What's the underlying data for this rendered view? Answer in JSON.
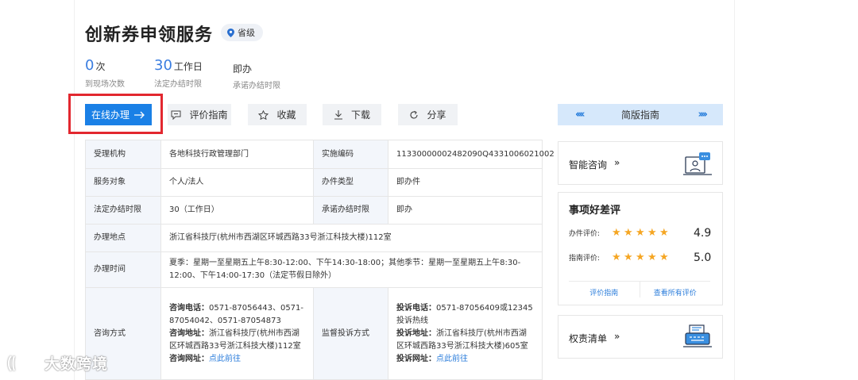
{
  "title": "创新券申领服务",
  "level_badge": "省级",
  "stats": [
    {
      "num": "0",
      "unit": "次",
      "label": "到现场次数"
    },
    {
      "num": "30",
      "unit": "工作日",
      "label": "法定办结时限"
    },
    {
      "text": "即办",
      "label": "承诺办结时限"
    }
  ],
  "toolbar": {
    "online_label": "在线办理",
    "review_label": "评价指南",
    "favorite_label": "收藏",
    "download_label": "下载",
    "share_label": "分享"
  },
  "guide": {
    "label": "简版指南",
    "left_arrows": "‹‹‹‹",
    "right_arrows": "››››"
  },
  "info": {
    "r1": {
      "k1": "受理机构",
      "v1": "各地科技行政管理部门",
      "k2": "实施编码",
      "v2": "11330000002482090Q4331006021002"
    },
    "r2": {
      "k1": "服务对象",
      "v1": "个人/法人",
      "k2": "办件类型",
      "v2": "即办件"
    },
    "r3": {
      "k1": "法定办结时限",
      "v1": "30（工作日）",
      "k2": "承诺办结时限",
      "v2": "即办"
    },
    "r4": {
      "k1": "办理地点",
      "v1": "浙江省科技厅(杭州市西湖区环城西路33号浙江科技大楼)112室"
    },
    "r5": {
      "k1": "办理时间",
      "v1": "夏季：星期一至星期五上午8:30-12:00、下午14:30-18:00；其他季节：星期一至星期五上午8:30-12:00、下午14:00-17:30（法定节假日除外）"
    },
    "r6": {
      "k1": "咨询方式",
      "consult": {
        "phone_label": "咨询电话：",
        "phone": "0571-87056443、0571-87054042、0571-87054873",
        "addr_label": "咨询地址：",
        "addr": "浙江省科技厅(杭州市西湖区环城西路33号浙江科技大楼)112室",
        "web_label": "咨询网址：",
        "web": "点此前往"
      },
      "k2": "监督投诉方式",
      "complaint": {
        "phone_label": "投诉电话：",
        "phone": "0571-87056409或12345投诉热线",
        "addr_label": "投诉地址：",
        "addr": "浙江省科技厅(杭州市西湖区环城西路33号浙江科技大楼)605室",
        "web_label": "投诉网址：",
        "web": "点此前往"
      }
    }
  },
  "sidebar": {
    "smart_consult": "智能咨询",
    "arrow": "»",
    "rating_title": "事项好差评",
    "ratings": [
      {
        "label": "办件评价:",
        "stars": 5,
        "score": "4.9"
      },
      {
        "label": "指南评价:",
        "stars": 5,
        "score": "5.0"
      }
    ],
    "rating_guide_link": "评价指南",
    "all_reviews_link": "查看所有评价",
    "duty_list": "权责清单"
  },
  "watermark": "大数跨境",
  "colors": {
    "primary": "#1a80e6",
    "highlight": "#e2272f",
    "star": "#f5a623",
    "link": "#2b7ddb"
  }
}
